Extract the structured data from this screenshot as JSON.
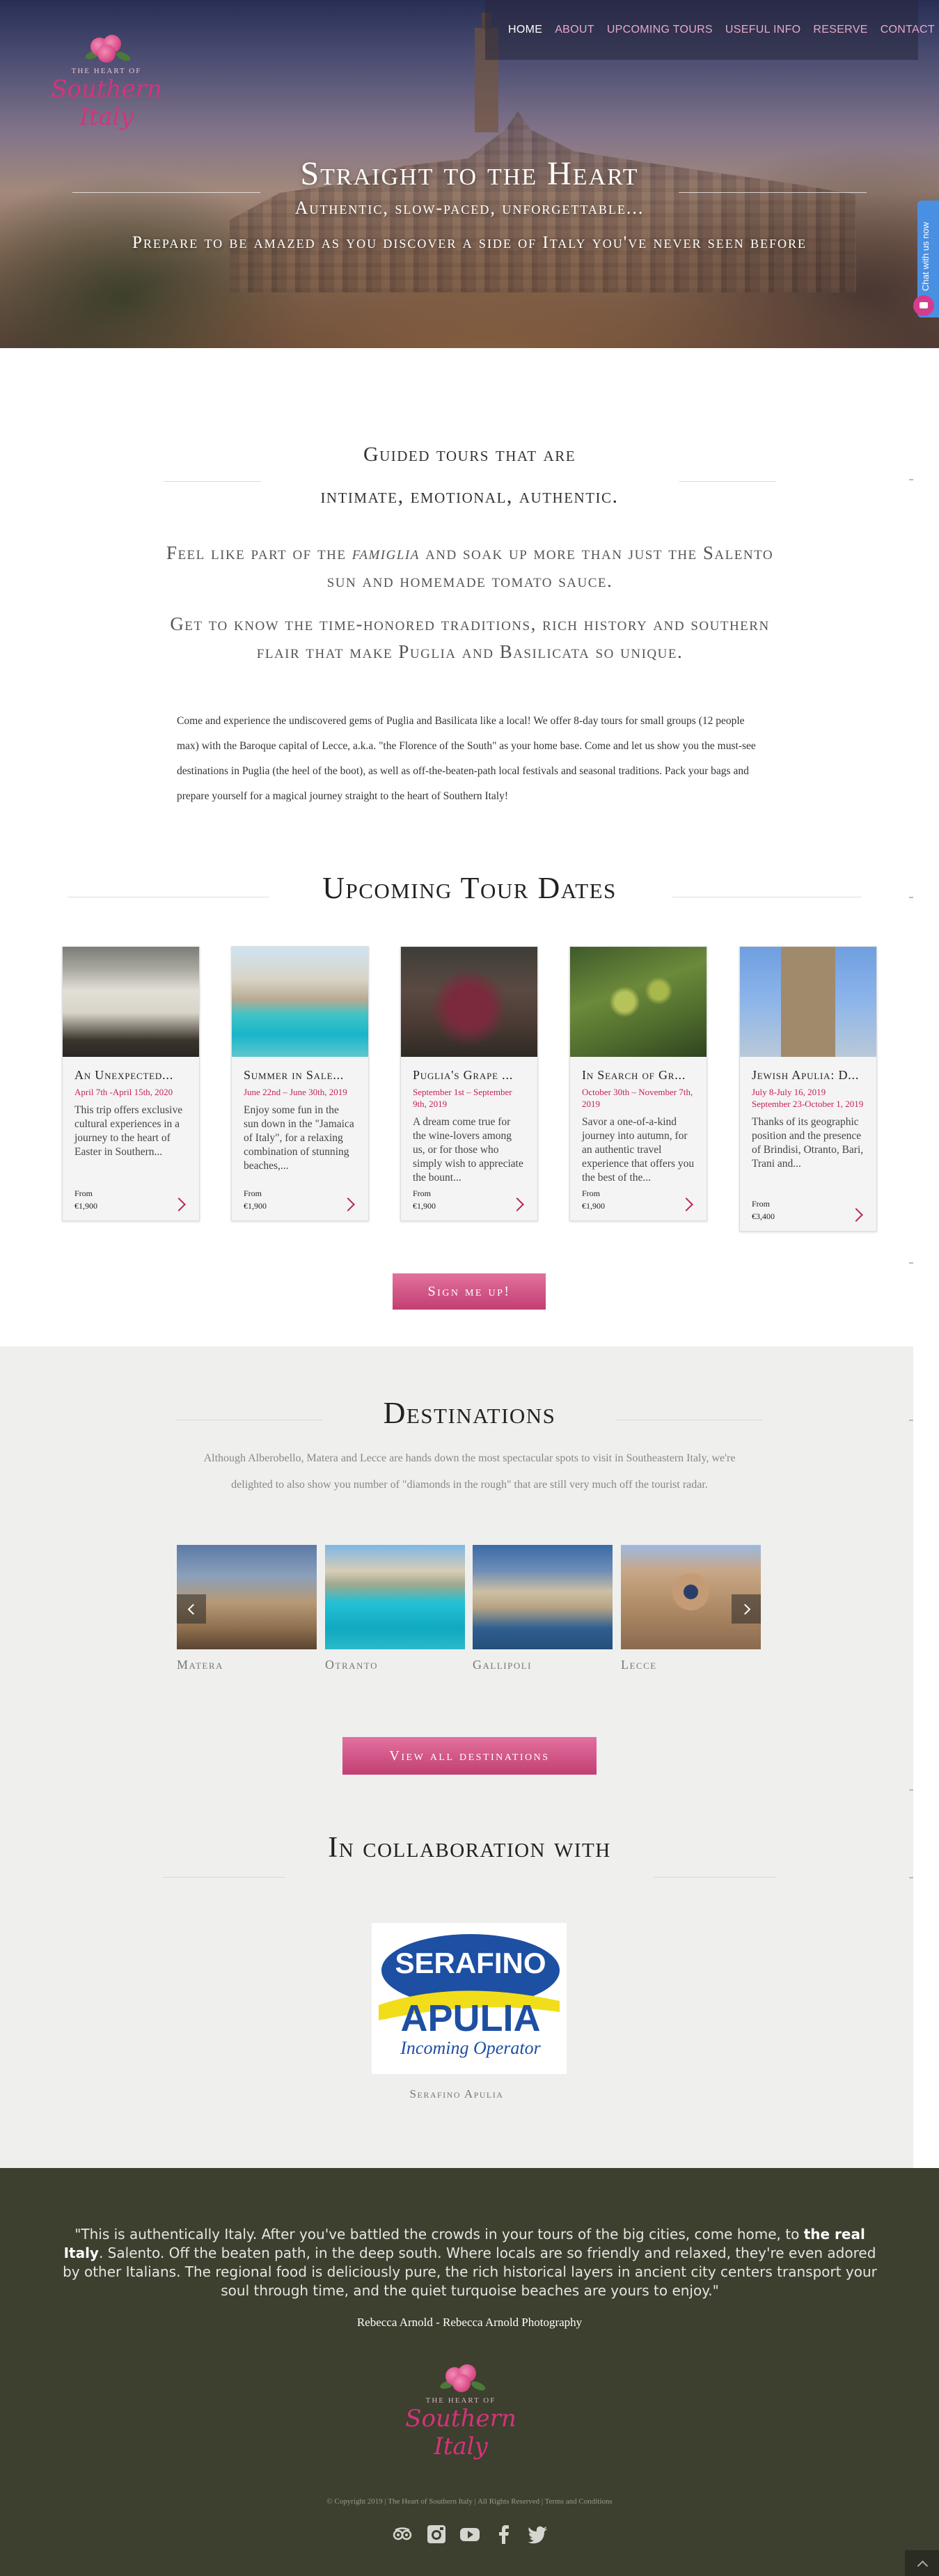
{
  "nav": {
    "items": [
      {
        "label": "HOME",
        "active": true
      },
      {
        "label": "ABOUT"
      },
      {
        "label": "UPCOMING TOURS"
      },
      {
        "label": "USEFUL INFO"
      },
      {
        "label": "RESERVE"
      },
      {
        "label": "CONTACT"
      }
    ]
  },
  "logo": {
    "top_text": "THE HEART OF",
    "script_text": "Southern Italy"
  },
  "hero": {
    "title": "Straight to the Heart",
    "subtitle": "Authentic, slow-paced, unforgettable...",
    "tagline": "Prepare to be amazed as you discover a side of Italy you've never seen before"
  },
  "chat": {
    "label": "Chat with us now"
  },
  "intro": {
    "heading_line1": "Guided tours that are",
    "heading_line2": "intimate, emotional, authentic.",
    "lead1_a": "Feel like part of the ",
    "lead1_em": "famiglia",
    "lead1_b": " and soak up more than just the Salento sun and homemade tomato sauce.",
    "lead2": "Get to know the time-honored traditions, rich history and southern flair that make Puglia and Basilicata so unique.",
    "body": "Come and experience the undiscovered gems of Puglia and Basilicata like a local! We offer 8-day tours for small groups (12 people max) with the Baroque capital of Lecce, a.k.a. \"the Florence of the South\" as your home base. Come and let us show you the must-see destinations in Puglia (the heel of the boot), as well as off-the-beaten-path local festivals and seasonal traditions. Pack your bags and prepare yourself for a magical journey straight to the heart of Southern Italy!"
  },
  "tours": {
    "title": "Upcoming Tour Dates",
    "from_label": "From",
    "items": [
      {
        "name": "An Unexpected...",
        "date": "April 7th -April 15th, 2020",
        "desc": "This trip offers exclusive cultural experiences in a journey to the heart of Easter in Southern...",
        "price": "€1,900"
      },
      {
        "name": "Summer in Sale...",
        "date": "June 22nd – June 30th, 2019",
        "desc": "Enjoy some fun in the sun down in the \"Jamaica of Italy\", for a relaxing combination of stunning beaches,...",
        "price": "€1,900"
      },
      {
        "name": "Puglia's Grape ...",
        "date": "September 1st – September 9th, 2019",
        "desc": "A dream come true for the wine-lovers among us, or for those who simply wish to appreciate the bount...",
        "price": "€1,900"
      },
      {
        "name": "In Search of Gr...",
        "date": "October 30th – November 7th, 2019",
        "desc": "Savor a one-of-a-kind journey into autumn, for an authentic travel experience that offers you the best of the...",
        "price": "€1,900"
      },
      {
        "name": "Jewish Apulia: D...",
        "date": "July 8-July 16, 2019 September 23-October 1, 2019",
        "desc": "Thanks of its geographic position and the presence of Brindisi, Otranto, Bari, Trani and...",
        "price": "€3,400"
      }
    ],
    "button": "Sign me up!"
  },
  "destinations": {
    "title": "Destinations",
    "intro": "Although Alberobello, Matera and Lecce are hands down the most spectacular spots to visit in Southeastern Italy, we're delighted to also show you number of \"diamonds in the rough\" that are still very much off the tourist radar.",
    "items": [
      {
        "name": "Matera"
      },
      {
        "name": "Otranto"
      },
      {
        "name": "Gallipoli"
      },
      {
        "name": "Lecce"
      }
    ],
    "button": "View all destinations"
  },
  "collab": {
    "title": "In collaboration with",
    "partner_logo_top": "SERAFINO",
    "partner_logo_mid": "APULIA",
    "partner_logo_sub": "Incoming Operator",
    "partner_name": "Serafino Apulia"
  },
  "footer": {
    "quote_a": "\"This is authentically Italy. After you've battled the crowds in your tours of the big cities, come home, to ",
    "quote_b": "the real Italy",
    "quote_c": ". Salento. Off the beaten path, in the deep south. Where locals are so friendly and relaxed, they're even adored by other Italians. The regional food is deliciously pure, the rich historical layers in ancient city centers transport your soul through time, and the quiet turquoise beaches are yours to enjoy.\"",
    "author": "Rebecca Arnold - Rebecca Arnold Photography",
    "copyright": "© Copyright 2019  |  The Heart of Southern Italy | All Rights Reserved | Terms and Conditions",
    "social": [
      "tripadvisor-icon",
      "instagram-icon",
      "youtube-icon",
      "facebook-icon",
      "twitter-icon"
    ]
  },
  "colors": {
    "accent": "#c4215a",
    "nav_pink": "#e8a9c9",
    "footer_bg": "#3d3f2f",
    "section_gray": "#efefed"
  }
}
